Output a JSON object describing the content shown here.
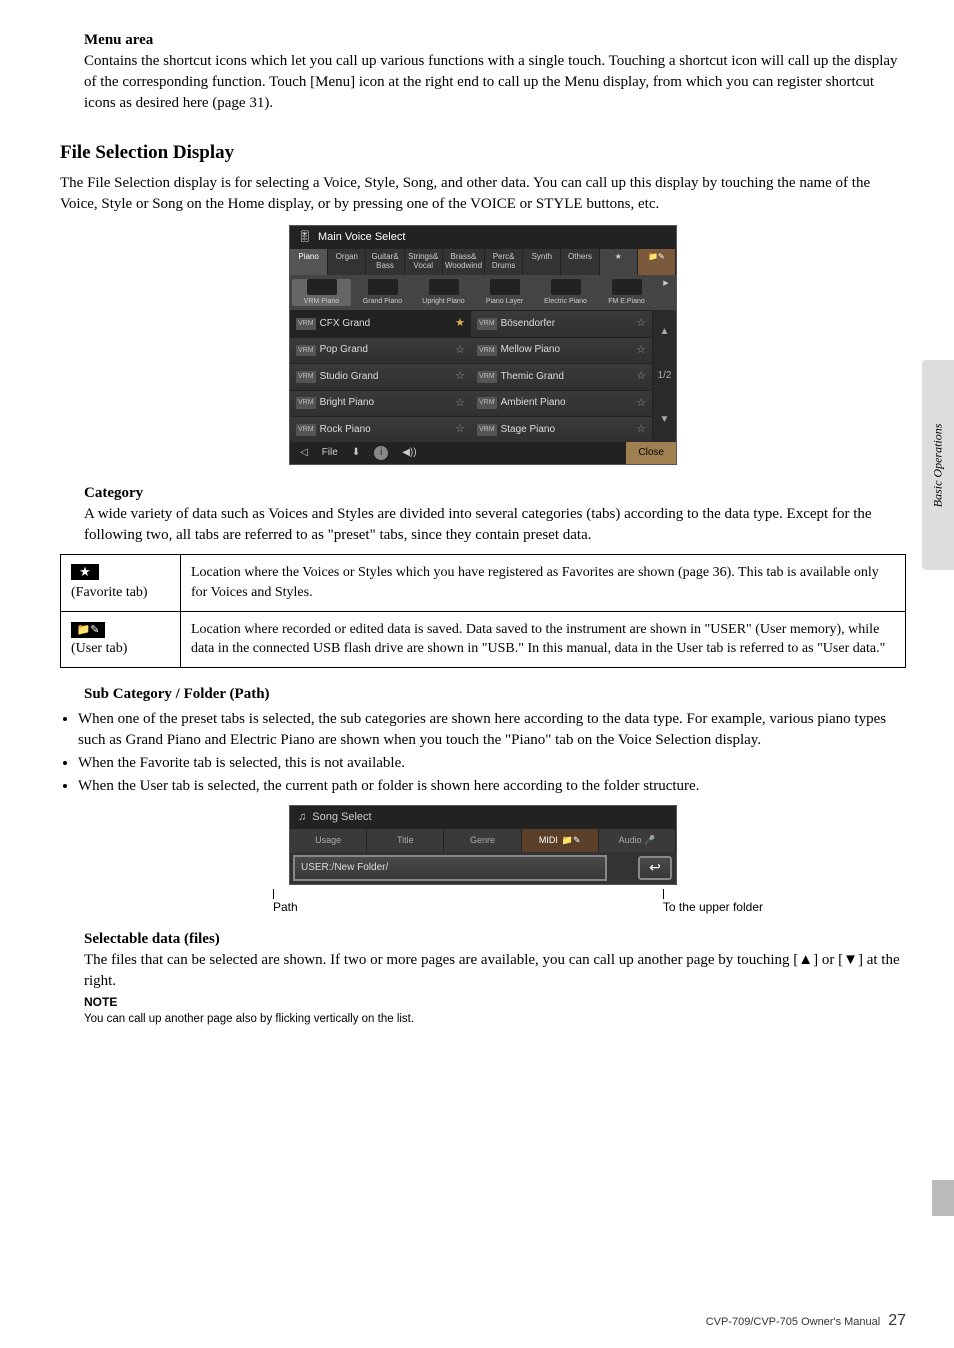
{
  "menuArea": {
    "heading": "Menu area",
    "text": "Contains the shortcut icons which let you call up various functions with a single touch. Touching a shortcut icon will call up the display of the corresponding function. Touch [Menu] icon at the right end to call up the Menu display, from which you can register shortcut icons as desired here (page 31)."
  },
  "fileSelection": {
    "heading": "File Selection Display",
    "intro": "The File Selection display is for selecting a Voice, Style, Song, and other data. You can call up this display by touching the name of the Voice, Style or Song on the Home display, or by pressing one of the VOICE or STYLE buttons, etc."
  },
  "mainVoiceScreenshot": {
    "title": "Main Voice Select",
    "tabs": [
      "Piano",
      "Organ",
      "Guitar&\nBass",
      "Strings&\nVocal",
      "Brass&\nWoodwind",
      "Perc&\nDrums",
      "Synth",
      "Others"
    ],
    "subcats": [
      "VRM Piano",
      "Grand Piano",
      "Upright Piano",
      "Piano Layer",
      "Electric Piano",
      "FM E.Piano"
    ],
    "listLeft": [
      "CFX Grand",
      "Pop Grand",
      "Studio Grand",
      "Bright Piano",
      "Rock Piano"
    ],
    "listRight": [
      "Bösendorfer",
      "Mellow Piano",
      "Themic Grand",
      "Ambient Piano",
      "Stage Piano"
    ],
    "page": "1/2",
    "file": "File",
    "close": "Close"
  },
  "sideTab": "Basic Operations",
  "category": {
    "heading": "Category",
    "text": "A wide variety of data such as Voices and Styles are divided into several categories (tabs) according to the data type. Except for the following two, all tabs are referred to as \"preset\" tabs, since they contain preset data.",
    "rows": [
      {
        "label": "(Favorite tab)",
        "desc": "Location where the Voices or Styles which you have registered as Favorites are shown (page 36). This tab is available only for Voices and Styles."
      },
      {
        "label": "(User tab)",
        "desc": "Location where recorded or edited data is saved. Data saved to the instrument are shown in \"USER\" (User memory), while data in the connected USB flash drive are shown in \"USB.\" In this manual, data in the User tab is referred to as \"User data.\""
      }
    ]
  },
  "subCategory": {
    "heading": "Sub Category / Folder (Path)",
    "bullets": [
      "When one of the preset tabs is selected, the sub categories are shown here according to the data type. For example, various piano types such as Grand Piano and Electric Piano are shown when you touch the \"Piano\" tab on the Voice Selection display.",
      "When the Favorite tab is selected, this is not available.",
      "When the User tab is selected, the current path or folder is shown here according to the folder structure."
    ]
  },
  "songSelectScreenshot": {
    "title": "Song Select",
    "tabs": [
      "Usage",
      "Title",
      "Genre",
      "MIDI",
      "Audio"
    ],
    "path": "USER:/New Folder/",
    "labelPath": "Path",
    "labelUp": "To the upper folder"
  },
  "selectable": {
    "heading": "Selectable data (files)",
    "text": "The files that can be selected are shown. If two or more pages are available, you can call up another page by touching [▲] or [▼] at the right.",
    "noteLabel": "NOTE",
    "noteText": "You can call up another page also by flicking vertically on the list."
  },
  "footer": {
    "manual": "CVP-709/CVP-705 Owner's Manual",
    "page": "27"
  }
}
